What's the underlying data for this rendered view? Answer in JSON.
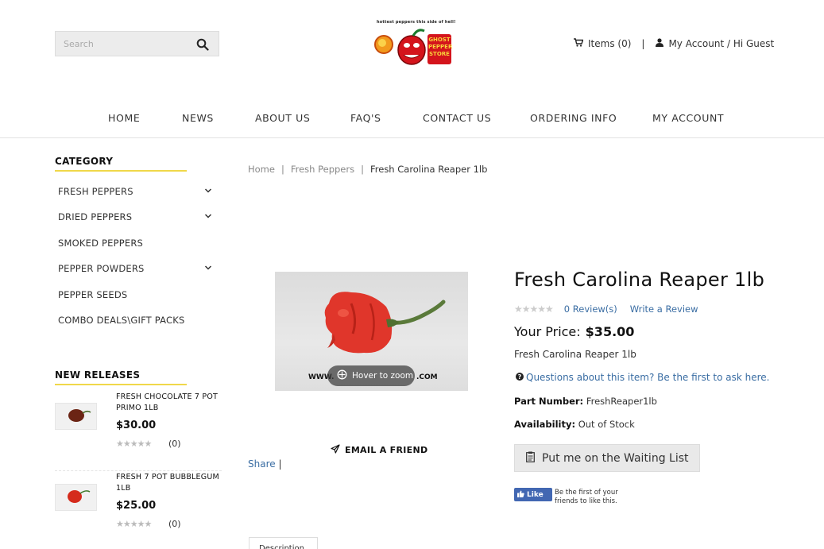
{
  "header": {
    "search_placeholder": "Search",
    "logo_tagline": "hottest peppers this side of hell!",
    "logo_text": "GHOST PEPPER STORE",
    "cart_label": "Items (0)",
    "separator": "|",
    "account_label": "My Account / Hi Guest"
  },
  "nav": {
    "items": [
      {
        "label": "HOME"
      },
      {
        "label": "NEWS"
      },
      {
        "label": "ABOUT US"
      },
      {
        "label": "FAQ'S"
      },
      {
        "label": "CONTACT US"
      },
      {
        "label": "ORDERING INFO"
      },
      {
        "label": "MY ACCOUNT"
      }
    ]
  },
  "sidebar": {
    "category_heading": "CATEGORY",
    "categories": [
      {
        "label": "FRESH PEPPERS",
        "expandable": true
      },
      {
        "label": "DRIED PEPPERS",
        "expandable": true
      },
      {
        "label": "SMOKED PEPPERS",
        "expandable": false
      },
      {
        "label": "PEPPER POWDERS",
        "expandable": true
      },
      {
        "label": "PEPPER SEEDS",
        "expandable": false
      },
      {
        "label": "COMBO DEALS\\GIFT PACKS",
        "expandable": false
      }
    ],
    "new_releases_heading": "NEW RELEASES",
    "new_releases": [
      {
        "name": "FRESH CHOCOLATE 7 POT PRIMO 1LB",
        "price": "$30.00",
        "reviews": "(0)"
      },
      {
        "name": "FRESH 7 POT BUBBLEGUM 1LB",
        "price": "$25.00",
        "reviews": "(0)"
      }
    ]
  },
  "breadcrumb": {
    "items": [
      "Home",
      "Fresh Peppers",
      "Fresh Carolina Reaper 1lb"
    ],
    "separator": "|"
  },
  "gallery": {
    "zoom_label": "Hover to zoom",
    "watermark_left": "WWW.",
    "watermark_right": ".COM"
  },
  "actions": {
    "email_friend": "EMAIL A FRIEND",
    "share": "Share",
    "share_bar": "|",
    "description_tab": "Description"
  },
  "product": {
    "title": "Fresh Carolina Reaper 1lb",
    "reviews_link": "0 Review(s)",
    "write_review": "Write a Review",
    "price_label": "Your Price:",
    "price": "$35.00",
    "short_description": "Fresh Carolina Reaper 1lb",
    "questions_link": "Questions about this item? Be the first to ask here.",
    "part_number_label": "Part Number:",
    "part_number": "FreshReaper1lb",
    "availability_label": "Availability:",
    "availability": "Out of Stock",
    "waiting_list_button": "Put me on the Waiting List",
    "rating_stars": 0
  },
  "facebook": {
    "like_label": "Like",
    "text": "Be the first of your friends to like this."
  },
  "colors": {
    "accent_yellow": "#f0d84a",
    "link_blue": "#3a6da3",
    "facebook_blue": "#4267b2"
  }
}
